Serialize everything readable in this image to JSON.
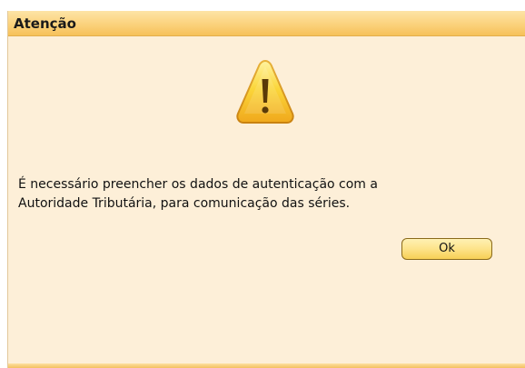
{
  "dialog": {
    "title": "Atenção",
    "icon": "warning-icon",
    "message_line1": "É necessário preencher os dados de autenticação com a",
    "message_line2": "Autoridade Tributária, para comunicação das séries.",
    "ok_label": "Ok"
  },
  "colors": {
    "titlebar": "#fbd27c",
    "background": "#fdefd8",
    "button": "#fde38a",
    "icon_fill": "#f7c52c"
  }
}
